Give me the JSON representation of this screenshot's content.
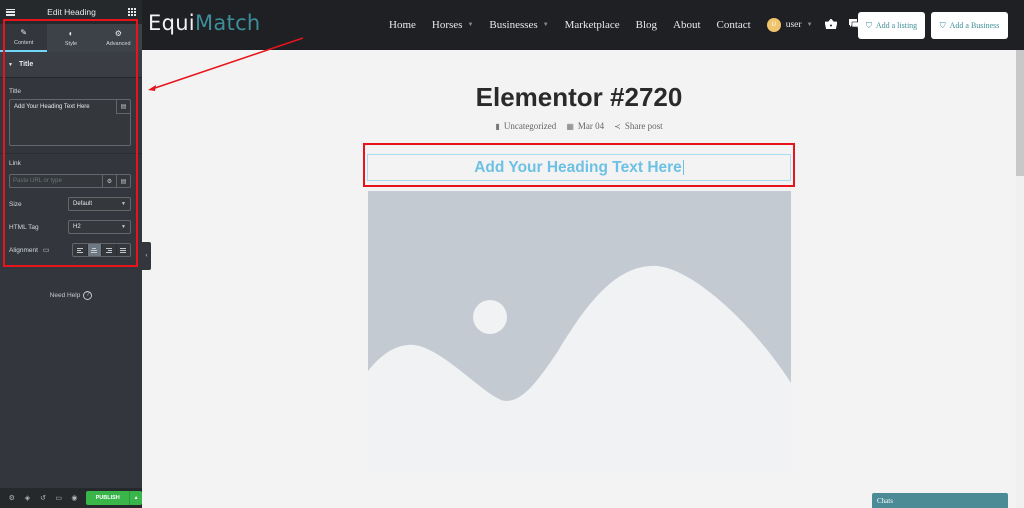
{
  "panel": {
    "header_title": "Edit Heading",
    "tabs": [
      {
        "label": "Content",
        "icon": "pencil-icon",
        "active": true
      },
      {
        "label": "Style",
        "icon": "half-circle-icon",
        "active": false
      },
      {
        "label": "Advanced",
        "icon": "gear-icon",
        "active": false
      }
    ],
    "section_title": "Title",
    "title_label": "Title",
    "title_value": "Add Your Heading Text Here",
    "link_label": "Link",
    "link_placeholder": "Paste URL or type",
    "size_label": "Size",
    "size_value": "Default",
    "html_tag_label": "HTML Tag",
    "html_tag_value": "H2",
    "alignment_label": "Alignment",
    "alignment_options": [
      "left",
      "center",
      "right",
      "justify"
    ],
    "alignment_selected": "center",
    "need_help": "Need Help",
    "publish_label": "PUBLISH",
    "accent_color": "#39b54a"
  },
  "site": {
    "logo_part1": "Equi",
    "logo_part2": "Match",
    "nav": [
      {
        "label": "Home",
        "dropdown": false
      },
      {
        "label": "Horses",
        "dropdown": true
      },
      {
        "label": "Businesses",
        "dropdown": true
      },
      {
        "label": "Marketplace",
        "dropdown": false
      },
      {
        "label": "Blog",
        "dropdown": false
      },
      {
        "label": "About",
        "dropdown": false
      },
      {
        "label": "Contact",
        "dropdown": false
      }
    ],
    "user_initial": "U",
    "user_name": "user",
    "add_listing": "Add a listing",
    "add_business": "Add a Business",
    "brand_color": "#3e8e9a"
  },
  "content": {
    "page_title": "Elementor #2720",
    "category": "Uncategorized",
    "date": "Mar 04",
    "share": "Share post",
    "heading_text": "Add Your Heading Text Here",
    "heading_color": "#6ec1e4",
    "chats_label": "Chats"
  }
}
